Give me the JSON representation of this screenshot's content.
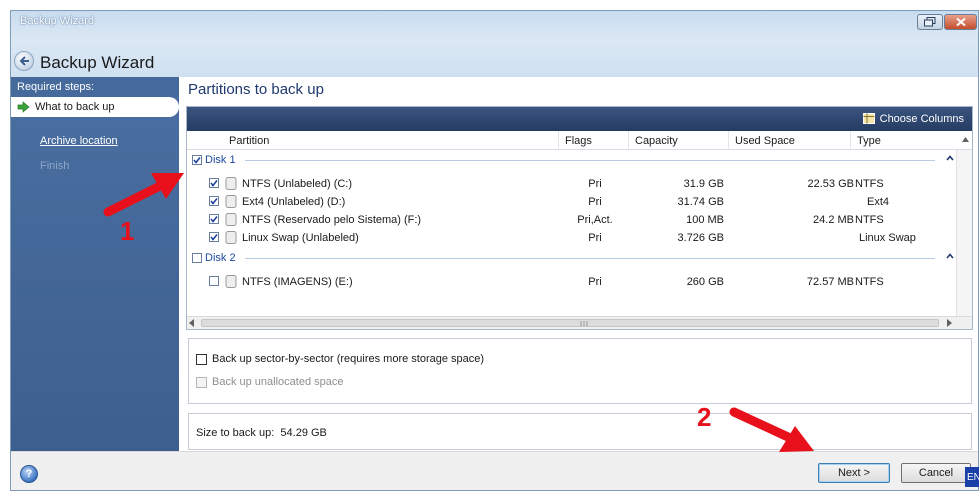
{
  "window": {
    "caption": "Backup Wizard",
    "title": "Backup Wizard"
  },
  "sidebar": {
    "heading": "Required steps:",
    "items": [
      {
        "label": "What to back up",
        "state": "active"
      },
      {
        "label": "Archive location",
        "state": "link"
      },
      {
        "label": "Finish",
        "state": "disabled"
      }
    ]
  },
  "main": {
    "title": "Partitions to back up",
    "toolbar": {
      "choose_columns": "Choose Columns"
    },
    "columns": [
      "Partition",
      "Flags",
      "Capacity",
      "Used Space",
      "Type"
    ],
    "disks": [
      {
        "label": "Disk 1",
        "checked": true,
        "partitions": [
          {
            "name": "NTFS (Unlabeled) (C:)",
            "flags": "Pri",
            "capacity": "31.9 GB",
            "used": "22.53 GB",
            "type": "NTFS",
            "checked": true
          },
          {
            "name": "Ext4 (Unlabeled) (D:)",
            "flags": "Pri",
            "capacity": "31.74 GB",
            "used": "",
            "type": "Ext4",
            "checked": true
          },
          {
            "name": "NTFS (Reservado pelo Sistema) (F:)",
            "flags": "Pri,Act.",
            "capacity": "100 MB",
            "used": "24.2 MB",
            "type": "NTFS",
            "checked": true
          },
          {
            "name": "Linux Swap (Unlabeled)",
            "flags": "Pri",
            "capacity": "3.726 GB",
            "used": "",
            "type": "Linux Swap",
            "checked": true
          }
        ]
      },
      {
        "label": "Disk 2",
        "checked": false,
        "partitions": [
          {
            "name": "NTFS (IMAGENS) (E:)",
            "flags": "Pri",
            "capacity": "260 GB",
            "used": "72.57 MB",
            "type": "NTFS",
            "checked": false
          }
        ]
      }
    ],
    "options": [
      {
        "label": "Back up sector-by-sector (requires more storage space)",
        "checked": false,
        "enabled": true
      },
      {
        "label": "Back up unallocated space",
        "checked": false,
        "enabled": false
      }
    ],
    "size_label": "Size to back up:",
    "size_value": "54.29 GB"
  },
  "footer": {
    "help": "?",
    "next": "Next >",
    "cancel": "Cancel",
    "lang": "EN"
  },
  "annotations": {
    "marker1": "1",
    "marker2": "2",
    "color": "#e8101a"
  },
  "colors": {
    "sidebar": "#456a9b",
    "toolbar": "#2f4770",
    "disk_label": "#1f4aa0",
    "title": "#1f3a6e"
  }
}
